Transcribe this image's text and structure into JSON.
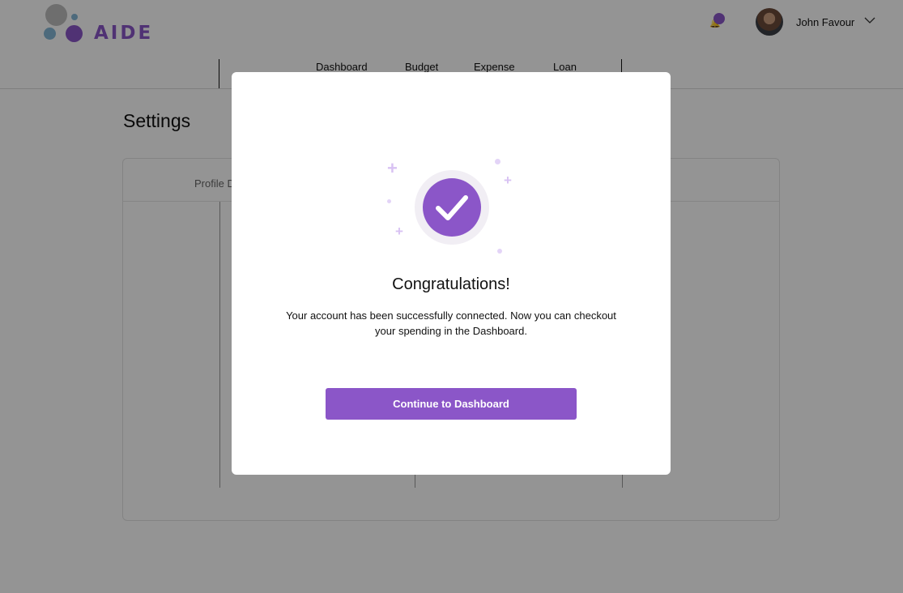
{
  "brand": {
    "name": "AIDE",
    "colors": {
      "primary": "#8b56c8",
      "accent_blue": "#86b7d6",
      "grey": "#bdbdbd"
    }
  },
  "header": {
    "notification_icon": "bell-icon",
    "user": {
      "name": "John Favour",
      "menu_icon": "chevron-down-icon"
    }
  },
  "nav": {
    "items": [
      {
        "label": "Dashboard"
      },
      {
        "label": "Budget"
      },
      {
        "label": "Expense"
      },
      {
        "label": "Loan"
      }
    ]
  },
  "page": {
    "title": "Settings",
    "tab_label_partial": "Profile D"
  },
  "modal": {
    "icon": "check-circle-icon",
    "title": "Congratulations!",
    "message": "Your account has been successfully connected. Now you can checkout your spending in the Dashboard.",
    "button_label": "Continue to Dashboard"
  }
}
